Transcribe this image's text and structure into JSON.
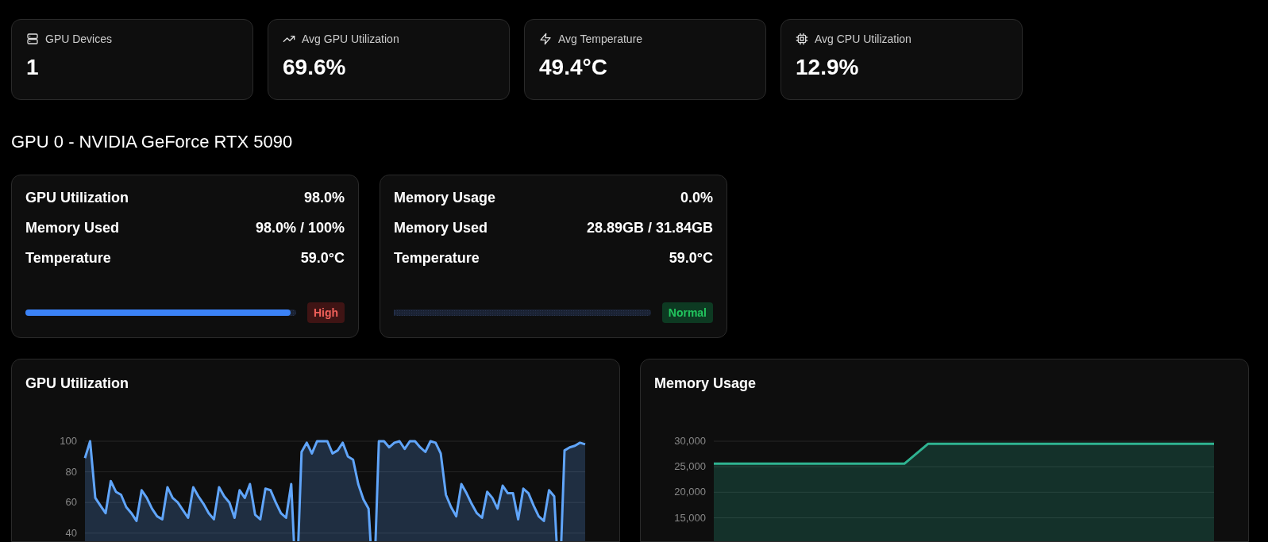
{
  "summary": [
    {
      "label": "GPU Devices",
      "value": "1"
    },
    {
      "label": "Avg GPU Utilization",
      "value": "69.6%"
    },
    {
      "label": "Avg Temperature",
      "value": "49.4°C"
    },
    {
      "label": "Avg CPU Utilization",
      "value": "12.9%"
    }
  ],
  "gpu_heading": "GPU 0 - NVIDIA GeForce RTX 5090",
  "gpu_cards": [
    {
      "rows": [
        {
          "label": "GPU Utilization",
          "value": "98.0%"
        },
        {
          "label": "Memory Used",
          "value": "98.0% / 100%"
        },
        {
          "label": "Temperature",
          "value": "59.0°C"
        }
      ],
      "level": 0.98,
      "badge": {
        "text": "High",
        "kind": "high"
      }
    },
    {
      "rows": [
        {
          "label": "Memory Usage",
          "value": "0.0%"
        },
        {
          "label": "Memory Used",
          "value": "28.89GB / 31.84GB"
        },
        {
          "label": "Temperature",
          "value": "59.0°C"
        }
      ],
      "level": 0,
      "badge": {
        "text": "Normal",
        "kind": "normal"
      }
    }
  ],
  "charts": [
    {
      "chart_data": {
        "type": "area",
        "title": "GPU Utilization",
        "grid": true,
        "ylim": [
          0,
          100
        ],
        "yticks": [
          40,
          60,
          80,
          100
        ],
        "series": [
          {
            "color": "#60a5fa",
            "values": [
              89,
              100,
              63,
              58,
              53,
              74,
              67,
              65,
              57,
              53,
              48,
              68,
              63,
              56,
              51,
              49,
              70,
              63,
              60,
              55,
              50,
              70,
              64,
              59,
              53,
              49,
              70,
              64,
              60,
              50,
              68,
              63,
              72,
              52,
              49,
              69,
              68,
              60,
              53,
              50,
              72,
              0,
              93,
              99,
              92,
              100,
              100,
              100,
              92,
              94,
              99,
              90,
              88,
              72,
              62,
              56,
              0,
              100,
              100,
              96,
              99,
              100,
              95,
              100,
              100,
              96,
              93,
              100,
              99,
              92,
              65,
              57,
              51,
              72,
              66,
              59,
              53,
              50,
              67,
              63,
              56,
              71,
              66,
              66,
              49,
              69,
              66,
              58,
              51,
              48,
              68,
              64,
              0,
              94,
              96,
              97,
              99,
              98
            ]
          }
        ]
      }
    },
    {
      "chart_data": {
        "type": "area",
        "title": "Memory Usage",
        "grid": true,
        "ylim": [
          0,
          30000
        ],
        "yticks": [
          {
            "value": 15000,
            "label": "15,000"
          },
          {
            "value": 20000,
            "label": "20,000"
          },
          {
            "value": 25000,
            "label": "25,000"
          },
          {
            "value": 30000,
            "label": "30,000"
          }
        ],
        "series": [
          {
            "color": "#2fb391",
            "values": [
              25600,
              25600,
              25600,
              25600,
              25600,
              25600,
              25600,
              25600,
              25600,
              29500,
              29500,
              29500,
              29500,
              29500,
              29500,
              29500,
              29500,
              29500,
              29500,
              29500,
              29500,
              29500
            ]
          }
        ]
      }
    }
  ]
}
